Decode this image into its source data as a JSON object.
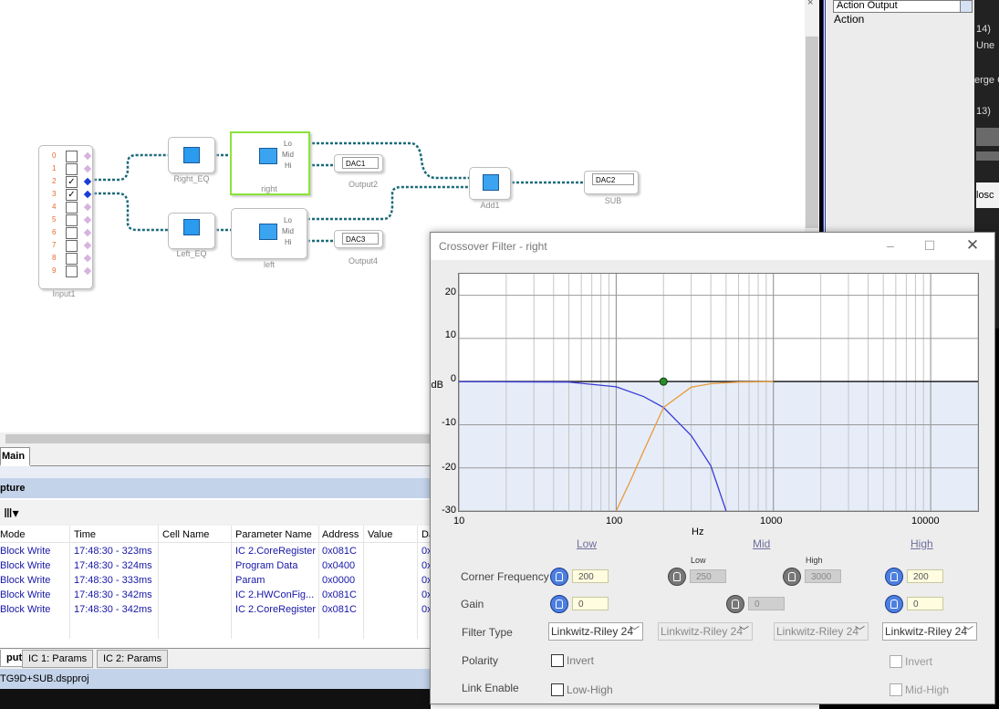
{
  "side_panel": {
    "dropdown": "Action Output",
    "label": "Action",
    "edge_texts": [
      "14)",
      "Une",
      "erge C",
      "13)",
      "losc"
    ]
  },
  "schematic": {
    "input_block": {
      "label": "Input1",
      "rows": [
        "0",
        "1",
        "2",
        "3",
        "4",
        "5",
        "6",
        "7",
        "8",
        "9"
      ]
    },
    "right_eq": {
      "label": "Right_EQ"
    },
    "left_eq": {
      "label": "Left_EQ"
    },
    "right_xo": {
      "label": "right",
      "ports": [
        "Lo",
        "Mid",
        "Hi"
      ]
    },
    "left_xo": {
      "label": "left",
      "ports": [
        "Lo",
        "Mid",
        "Hi"
      ]
    },
    "add": {
      "label": "Add1"
    },
    "dac1": {
      "value": "DAC1",
      "label": "Output2"
    },
    "dac2": {
      "value": "DAC2",
      "label": "SUB"
    },
    "dac3": {
      "value": "DAC3",
      "label": "Output4"
    }
  },
  "tabs_top": {
    "main": "Main"
  },
  "capture": {
    "title": "pture",
    "columns": [
      "Mode",
      "Time",
      "Cell Name",
      "Parameter Name",
      "Address",
      "Value",
      "Da"
    ],
    "rows": [
      {
        "mode": "Block Write",
        "time": "17:48:30 - 323ms",
        "cell": "",
        "param": "IC 2.CoreRegister",
        "addr": "0x081C",
        "value": "",
        "da": "0x"
      },
      {
        "mode": "Block Write",
        "time": "17:48:30 - 324ms",
        "cell": "",
        "param": "Program Data",
        "addr": "0x0400",
        "value": "",
        "da": "0x"
      },
      {
        "mode": "Block Write",
        "time": "17:48:30 - 333ms",
        "cell": "",
        "param": "Param",
        "addr": "0x0000",
        "value": "",
        "da": "0x"
      },
      {
        "mode": "Block Write",
        "time": "17:48:30 - 342ms",
        "cell": "",
        "param": "IC 2.HWConFig...",
        "addr": "0x081C",
        "value": "",
        "da": "0x"
      },
      {
        "mode": "Block Write",
        "time": "17:48:30 - 342ms",
        "cell": "",
        "param": "IC 2.CoreRegister",
        "addr": "0x081C",
        "value": "",
        "da": "0x"
      }
    ]
  },
  "bottom_tabs": [
    "put",
    "IC 1: Params",
    "IC 2: Params"
  ],
  "status": "TG9D+SUB.dspproj",
  "dialog": {
    "title": "Crossover Filter - right",
    "graph": {
      "ylabel": "dB",
      "xlabel": "Hz",
      "yticks": [
        "20",
        "10",
        "0",
        "-10",
        "-20",
        "-30"
      ],
      "xticks": [
        "10",
        "100",
        "1000",
        "10000"
      ]
    },
    "bands": [
      "Low",
      "Mid",
      "High"
    ],
    "corner_label": "Corner Frequency",
    "gain_label": "Gain",
    "filter_type_label": "Filter Type",
    "polarity_label": "Polarity",
    "link_label": "Link Enable",
    "mid_low_label": "Low",
    "mid_high_label": "High",
    "low_freq": "200",
    "mid_low_freq": "250",
    "mid_high_freq": "3000",
    "high_freq": "200",
    "low_gain": "0",
    "mid_gain": "0",
    "high_gain": "0",
    "filter_low": "Linkwitz-Riley 24",
    "filter_mid_low": "Linkwitz-Riley 24",
    "filter_mid_high": "Linkwitz-Riley 24",
    "filter_high": "Linkwitz-Riley 24",
    "invert_low": "Invert",
    "invert_high": "Invert",
    "link_low_high": "Low-High",
    "link_mid_high": "Mid-High"
  },
  "chart_data": {
    "type": "line",
    "title": "",
    "xlabel": "Hz",
    "ylabel": "dB",
    "x_scale": "log",
    "xlim": [
      10,
      20000
    ],
    "ylim": [
      -30,
      25
    ],
    "series": [
      {
        "x": [
          10,
          50,
          100,
          150,
          200,
          300,
          400,
          500
        ],
        "y": [
          0,
          -0.1,
          -1.2,
          -3.5,
          -6,
          -12.5,
          -19.5,
          -30
        ]
      },
      {
        "x": [
          100,
          125,
          150,
          200,
          300,
          400,
          600,
          1000
        ],
        "y": [
          -30,
          -22.5,
          -16,
          -6,
          -1.3,
          -0.5,
          -0.1,
          0
        ]
      }
    ],
    "marker": {
      "x": 200,
      "y": 0
    }
  }
}
